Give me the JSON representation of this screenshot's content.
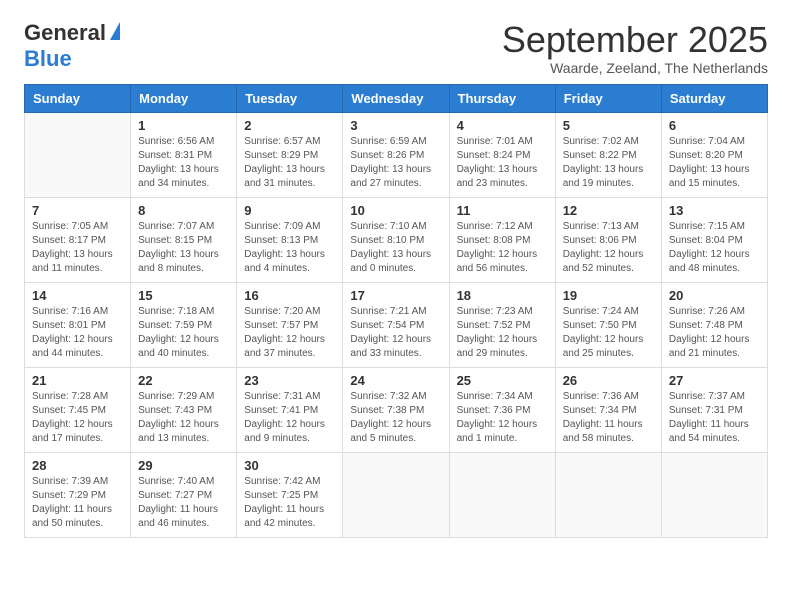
{
  "logo": {
    "general": "General",
    "blue": "Blue"
  },
  "title": "September 2025",
  "subtitle": "Waarde, Zeeland, The Netherlands",
  "days_of_week": [
    "Sunday",
    "Monday",
    "Tuesday",
    "Wednesday",
    "Thursday",
    "Friday",
    "Saturday"
  ],
  "weeks": [
    [
      {
        "day": "",
        "info": ""
      },
      {
        "day": "1",
        "info": "Sunrise: 6:56 AM\nSunset: 8:31 PM\nDaylight: 13 hours\nand 34 minutes."
      },
      {
        "day": "2",
        "info": "Sunrise: 6:57 AM\nSunset: 8:29 PM\nDaylight: 13 hours\nand 31 minutes."
      },
      {
        "day": "3",
        "info": "Sunrise: 6:59 AM\nSunset: 8:26 PM\nDaylight: 13 hours\nand 27 minutes."
      },
      {
        "day": "4",
        "info": "Sunrise: 7:01 AM\nSunset: 8:24 PM\nDaylight: 13 hours\nand 23 minutes."
      },
      {
        "day": "5",
        "info": "Sunrise: 7:02 AM\nSunset: 8:22 PM\nDaylight: 13 hours\nand 19 minutes."
      },
      {
        "day": "6",
        "info": "Sunrise: 7:04 AM\nSunset: 8:20 PM\nDaylight: 13 hours\nand 15 minutes."
      }
    ],
    [
      {
        "day": "7",
        "info": "Sunrise: 7:05 AM\nSunset: 8:17 PM\nDaylight: 13 hours\nand 11 minutes."
      },
      {
        "day": "8",
        "info": "Sunrise: 7:07 AM\nSunset: 8:15 PM\nDaylight: 13 hours\nand 8 minutes."
      },
      {
        "day": "9",
        "info": "Sunrise: 7:09 AM\nSunset: 8:13 PM\nDaylight: 13 hours\nand 4 minutes."
      },
      {
        "day": "10",
        "info": "Sunrise: 7:10 AM\nSunset: 8:10 PM\nDaylight: 13 hours\nand 0 minutes."
      },
      {
        "day": "11",
        "info": "Sunrise: 7:12 AM\nSunset: 8:08 PM\nDaylight: 12 hours\nand 56 minutes."
      },
      {
        "day": "12",
        "info": "Sunrise: 7:13 AM\nSunset: 8:06 PM\nDaylight: 12 hours\nand 52 minutes."
      },
      {
        "day": "13",
        "info": "Sunrise: 7:15 AM\nSunset: 8:04 PM\nDaylight: 12 hours\nand 48 minutes."
      }
    ],
    [
      {
        "day": "14",
        "info": "Sunrise: 7:16 AM\nSunset: 8:01 PM\nDaylight: 12 hours\nand 44 minutes."
      },
      {
        "day": "15",
        "info": "Sunrise: 7:18 AM\nSunset: 7:59 PM\nDaylight: 12 hours\nand 40 minutes."
      },
      {
        "day": "16",
        "info": "Sunrise: 7:20 AM\nSunset: 7:57 PM\nDaylight: 12 hours\nand 37 minutes."
      },
      {
        "day": "17",
        "info": "Sunrise: 7:21 AM\nSunset: 7:54 PM\nDaylight: 12 hours\nand 33 minutes."
      },
      {
        "day": "18",
        "info": "Sunrise: 7:23 AM\nSunset: 7:52 PM\nDaylight: 12 hours\nand 29 minutes."
      },
      {
        "day": "19",
        "info": "Sunrise: 7:24 AM\nSunset: 7:50 PM\nDaylight: 12 hours\nand 25 minutes."
      },
      {
        "day": "20",
        "info": "Sunrise: 7:26 AM\nSunset: 7:48 PM\nDaylight: 12 hours\nand 21 minutes."
      }
    ],
    [
      {
        "day": "21",
        "info": "Sunrise: 7:28 AM\nSunset: 7:45 PM\nDaylight: 12 hours\nand 17 minutes."
      },
      {
        "day": "22",
        "info": "Sunrise: 7:29 AM\nSunset: 7:43 PM\nDaylight: 12 hours\nand 13 minutes."
      },
      {
        "day": "23",
        "info": "Sunrise: 7:31 AM\nSunset: 7:41 PM\nDaylight: 12 hours\nand 9 minutes."
      },
      {
        "day": "24",
        "info": "Sunrise: 7:32 AM\nSunset: 7:38 PM\nDaylight: 12 hours\nand 5 minutes."
      },
      {
        "day": "25",
        "info": "Sunrise: 7:34 AM\nSunset: 7:36 PM\nDaylight: 12 hours\nand 1 minute."
      },
      {
        "day": "26",
        "info": "Sunrise: 7:36 AM\nSunset: 7:34 PM\nDaylight: 11 hours\nand 58 minutes."
      },
      {
        "day": "27",
        "info": "Sunrise: 7:37 AM\nSunset: 7:31 PM\nDaylight: 11 hours\nand 54 minutes."
      }
    ],
    [
      {
        "day": "28",
        "info": "Sunrise: 7:39 AM\nSunset: 7:29 PM\nDaylight: 11 hours\nand 50 minutes."
      },
      {
        "day": "29",
        "info": "Sunrise: 7:40 AM\nSunset: 7:27 PM\nDaylight: 11 hours\nand 46 minutes."
      },
      {
        "day": "30",
        "info": "Sunrise: 7:42 AM\nSunset: 7:25 PM\nDaylight: 11 hours\nand 42 minutes."
      },
      {
        "day": "",
        "info": ""
      },
      {
        "day": "",
        "info": ""
      },
      {
        "day": "",
        "info": ""
      },
      {
        "day": "",
        "info": ""
      }
    ]
  ]
}
